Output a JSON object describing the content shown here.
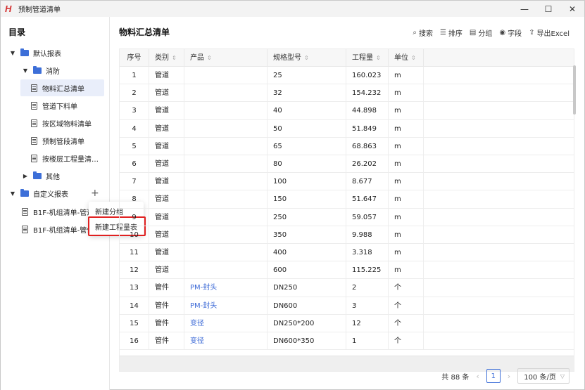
{
  "window": {
    "title": "预制管道清单",
    "logo": "H",
    "minimize": "—",
    "maximize": "☐",
    "close": "✕"
  },
  "sidebar": {
    "title": "目录",
    "default_reports": "默认报表",
    "fire": "消防",
    "items": [
      "物料汇总清单",
      "管道下料单",
      "按区域物料清单",
      "预制管段清单",
      "按楼层工程量清…"
    ],
    "other": "其他",
    "custom_reports": "自定义报表",
    "custom_items": [
      "B1F-机组清单-管道",
      "B1F-机组清单-管件"
    ],
    "add": "+"
  },
  "context_menu": {
    "new_group": "新建分组",
    "new_quantity_table": "新建工程量表"
  },
  "main": {
    "title": "物料汇总清单",
    "toolbar": {
      "search": "搜索",
      "sort": "排序",
      "group": "分组",
      "fields": "字段",
      "export": "导出Excel"
    },
    "columns": [
      "序号",
      "类别",
      "产品",
      "规格型号",
      "工程量",
      "单位"
    ],
    "rows": [
      [
        "1",
        "管道",
        "",
        "25",
        "160.023",
        "m"
      ],
      [
        "2",
        "管道",
        "",
        "32",
        "154.232",
        "m"
      ],
      [
        "3",
        "管道",
        "",
        "40",
        "44.898",
        "m"
      ],
      [
        "4",
        "管道",
        "",
        "50",
        "51.849",
        "m"
      ],
      [
        "5",
        "管道",
        "",
        "65",
        "68.863",
        "m"
      ],
      [
        "6",
        "管道",
        "",
        "80",
        "26.202",
        "m"
      ],
      [
        "7",
        "管道",
        "",
        "100",
        "8.677",
        "m"
      ],
      [
        "8",
        "管道",
        "",
        "150",
        "51.647",
        "m"
      ],
      [
        "9",
        "管道",
        "",
        "250",
        "59.057",
        "m"
      ],
      [
        "10",
        "管道",
        "",
        "350",
        "9.988",
        "m"
      ],
      [
        "11",
        "管道",
        "",
        "400",
        "3.318",
        "m"
      ],
      [
        "12",
        "管道",
        "",
        "600",
        "115.225",
        "m"
      ],
      [
        "13",
        "管件",
        "PM-封头",
        "DN250",
        "2",
        "个"
      ],
      [
        "14",
        "管件",
        "PM-封头",
        "DN600",
        "3",
        "个"
      ],
      [
        "15",
        "管件",
        "变径",
        "DN250*200",
        "12",
        "个"
      ],
      [
        "16",
        "管件",
        "变径",
        "DN600*350",
        "1",
        "个"
      ]
    ],
    "pager": {
      "total": "共 88 条",
      "page": "1",
      "page_size": "100 条/页",
      "prev": "‹",
      "next": "›"
    }
  },
  "colors": {
    "accent": "#3d6fd8",
    "link": "#3a68d6",
    "highlight_border": "#e02020",
    "logo": "#d32f2f"
  }
}
